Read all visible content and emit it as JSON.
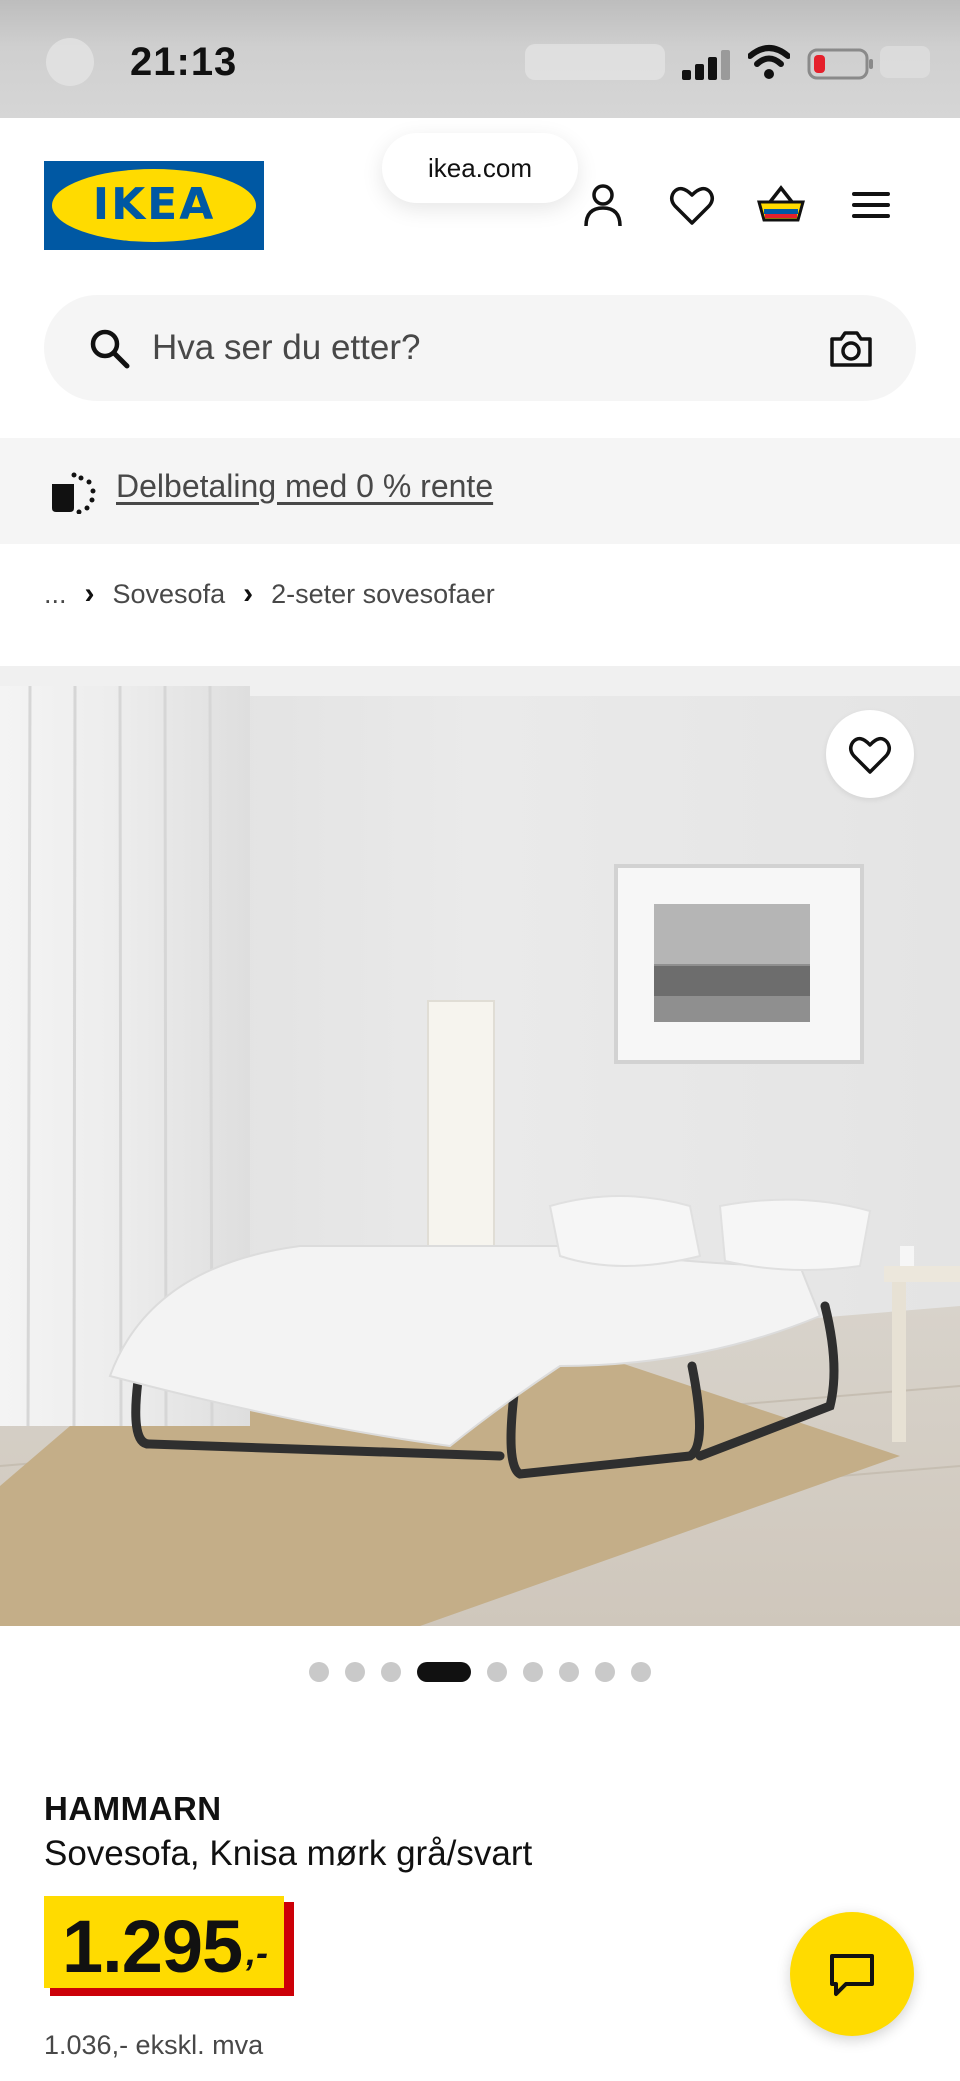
{
  "status_bar": {
    "time": "21:13"
  },
  "header": {
    "logo_text": "IKEA",
    "url": "ikea.com",
    "icons": [
      "user-icon",
      "heart-icon",
      "basket-icon",
      "menu-icon"
    ]
  },
  "search": {
    "placeholder": "Hva ser du etter?",
    "icons": [
      "search-icon",
      "camera-icon"
    ]
  },
  "promo": {
    "link": "Delbetaling med 0 % rente"
  },
  "breadcrumb": {
    "items": [
      "...",
      "Sovesofa",
      "2-seter sovesofaer"
    ]
  },
  "gallery": {
    "total_images": 9,
    "active_index": 3
  },
  "product": {
    "brand": "HAMMARN",
    "name": "Sovesofa, Knisa mørk grå/svart",
    "price": "1.295",
    "price_suffix": ",-",
    "price_ex_vat": "1.036,- ekskl. mva"
  },
  "colors": {
    "ikea_blue": "#0058a3",
    "ikea_yellow": "#ffdb00",
    "price_shadow_red": "#cc0008"
  }
}
